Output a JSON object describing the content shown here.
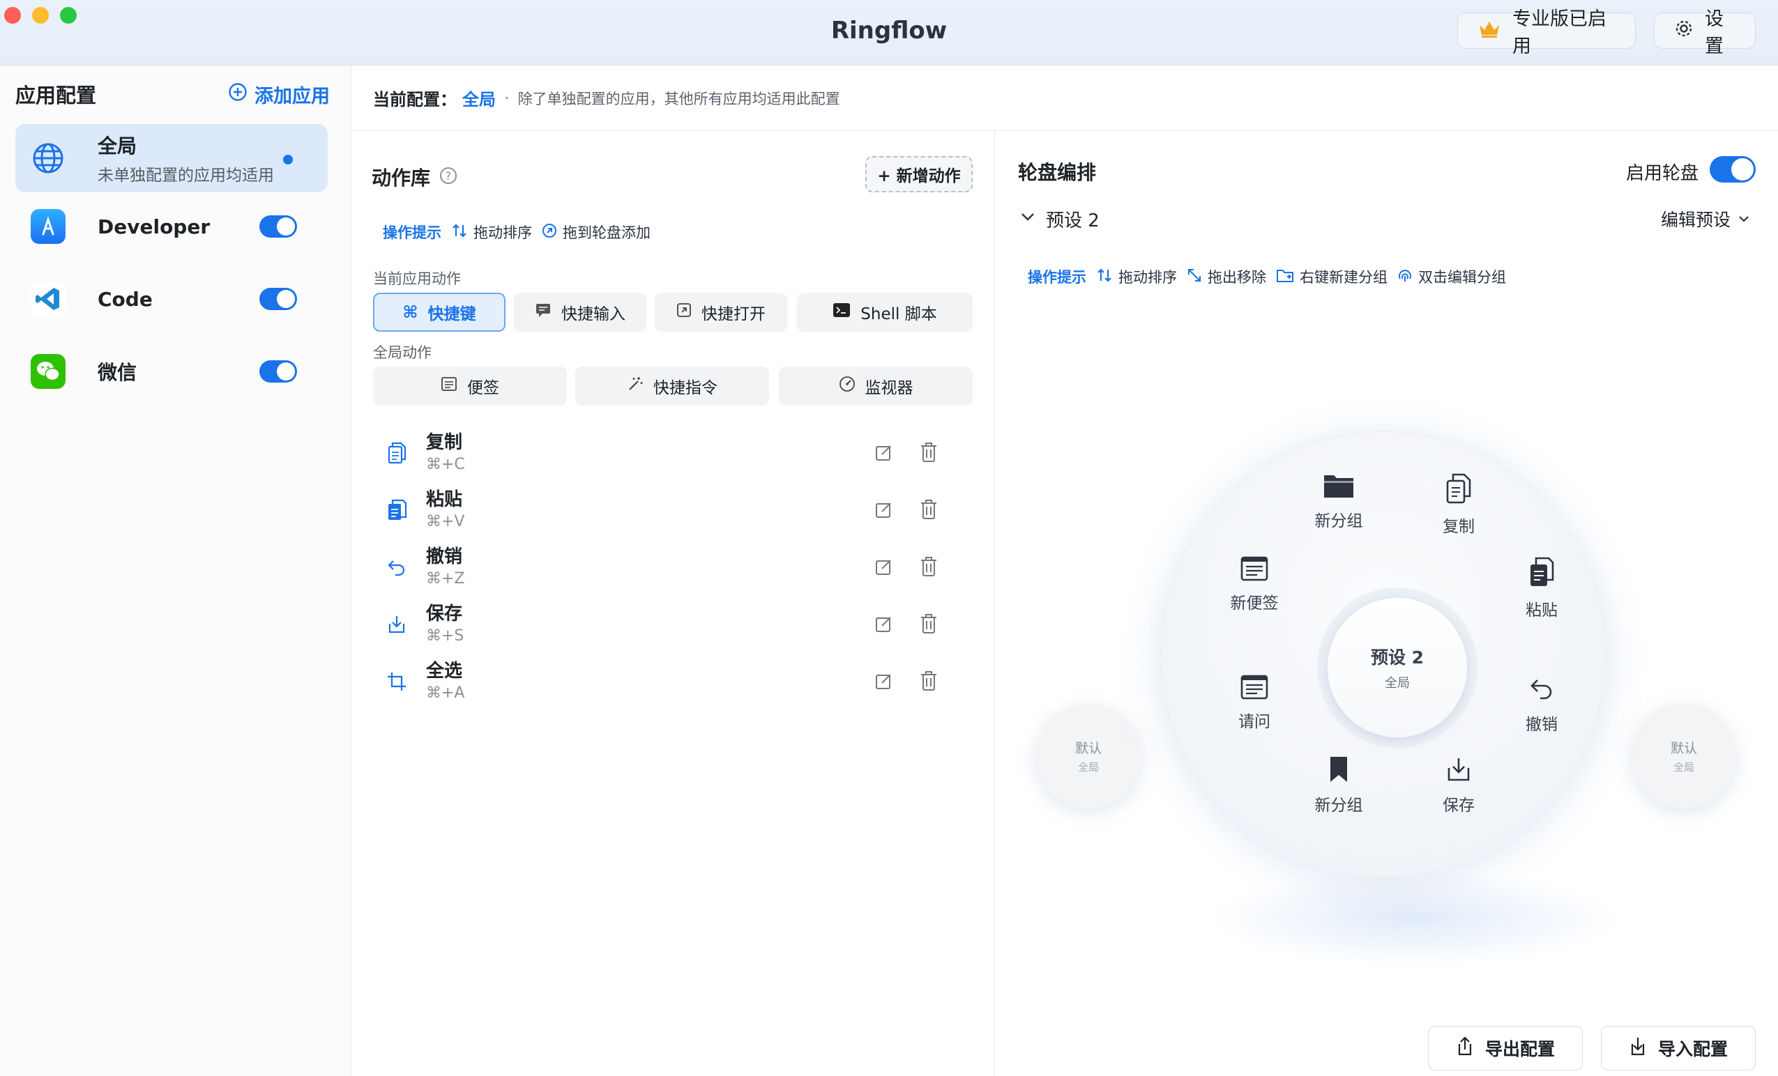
{
  "window": {
    "title": "Ringflow",
    "pro_label": "专业版已启用",
    "settings_label": "设置"
  },
  "sidebar": {
    "title": "应用配置",
    "add_label": "添加应用",
    "items": [
      {
        "name": "全局",
        "sub": "未单独配置的应用均适用",
        "active": true
      },
      {
        "name": "Developer",
        "enabled": true
      },
      {
        "name": "Code",
        "enabled": true
      },
      {
        "name": "微信",
        "enabled": true
      }
    ]
  },
  "config": {
    "label": "当前配置：",
    "value": "全局",
    "sep": "·",
    "desc": "除了单独配置的应用，其他所有应用均适用此配置"
  },
  "library": {
    "title": "动作库",
    "add_action": "+ 新增动作",
    "hints": {
      "tip": "操作提示",
      "drag_sort": "拖动排序",
      "drag_add": "拖到轮盘添加"
    },
    "current_label": "当前应用动作",
    "current_chips": [
      "快捷键",
      "快捷输入",
      "快捷打开",
      "Shell 脚本"
    ],
    "global_label": "全局动作",
    "global_chips": [
      "便签",
      "快捷指令",
      "监视器"
    ],
    "actions": [
      {
        "name": "复制",
        "key": "⌘+C"
      },
      {
        "name": "粘贴",
        "key": "⌘+V"
      },
      {
        "name": "撤销",
        "key": "⌘+Z"
      },
      {
        "name": "保存",
        "key": "⌘+S"
      },
      {
        "name": "全选",
        "key": "⌘+A"
      }
    ]
  },
  "editor": {
    "title": "轮盘编排",
    "enable_label": "启用轮盘",
    "enabled": true,
    "preset": "预设 2",
    "edit_preset": "编辑预设",
    "hints": {
      "tip": "操作提示",
      "drag_sort": "拖动排序",
      "drag_remove": "拖出移除",
      "right_new_group": "右键新建分组",
      "dbl_edit_group": "双击编辑分组"
    },
    "hub": {
      "name": "预设 2",
      "sub": "全局"
    },
    "slots": [
      "新分组",
      "复制",
      "粘贴",
      "撤销",
      "保存",
      "新分组",
      "请问",
      "新便签"
    ],
    "side_left": {
      "name": "默认",
      "sub": "全局"
    },
    "side_right": {
      "name": "默认",
      "sub": "全局"
    },
    "export_label": "导出配置",
    "import_label": "导入配置"
  },
  "colors": {
    "accent": "#1a73e8",
    "active_bg": "#dce9fb"
  }
}
